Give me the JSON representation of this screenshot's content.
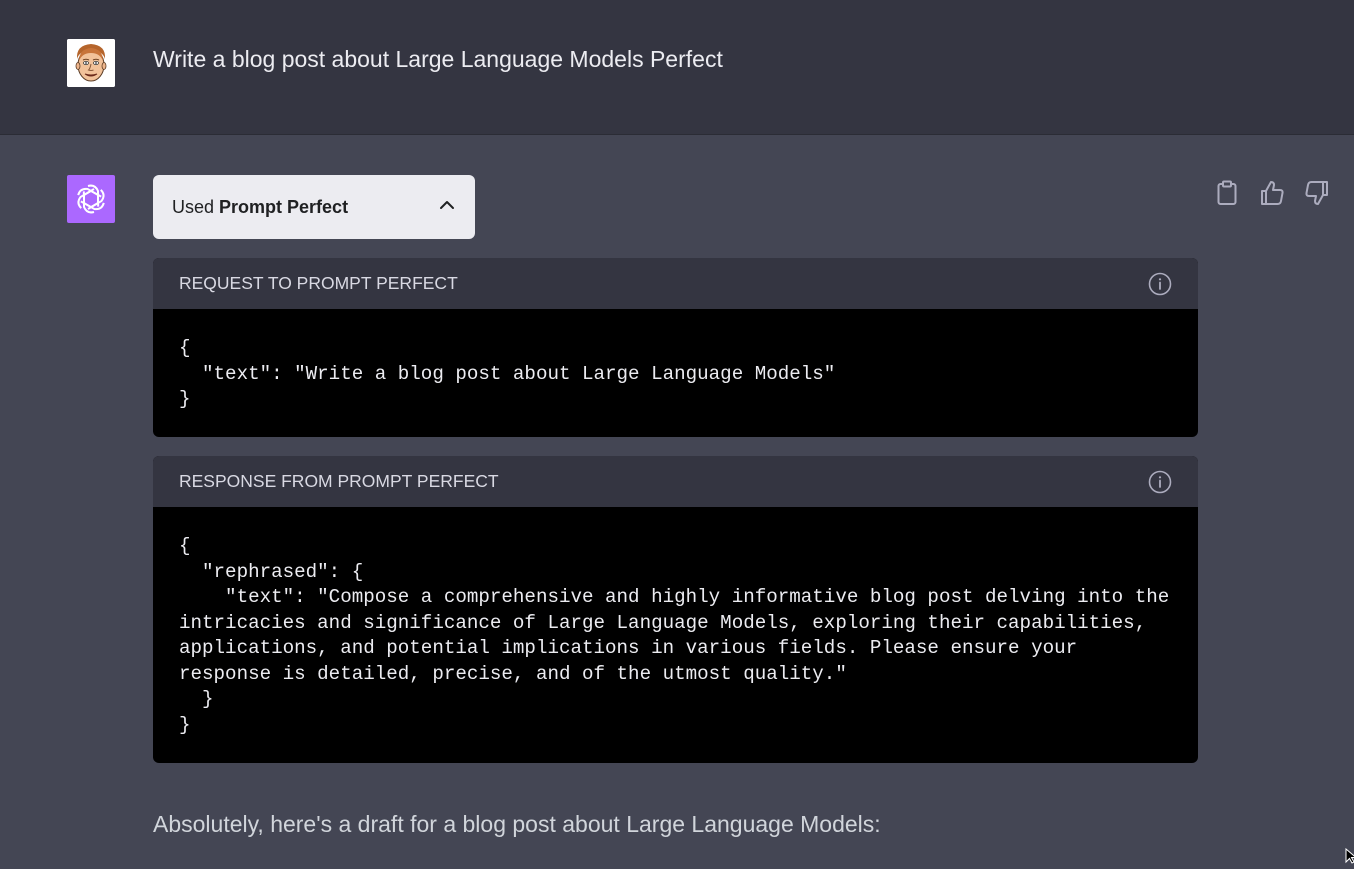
{
  "user": {
    "message": "Write a blog post about Large Language Models Perfect"
  },
  "assistant": {
    "plugin_used_prefix": "Used ",
    "plugin_name": "Prompt Perfect",
    "request_panel": {
      "title": "REQUEST TO PROMPT PERFECT",
      "code": "{\n  \"text\": \"Write a blog post about Large Language Models\"\n}"
    },
    "response_panel": {
      "title": "RESPONSE FROM PROMPT PERFECT",
      "code": "{\n  \"rephrased\": {\n    \"text\": \"Compose a comprehensive and highly informative blog post delving into the\nintricacies and significance of Large Language Models, exploring their capabilities,\napplications, and potential implications in various fields. Please ensure your\nresponse is detailed, precise, and of the utmost quality.\"\n  }\n}"
    },
    "answer_intro": "Absolutely, here's a draft for a blog post about Large Language Models:"
  },
  "icons": {
    "copy": "clipboard-icon",
    "like": "thumbs-up-icon",
    "dislike": "thumbs-down-icon",
    "collapse": "chevron-up-icon",
    "info": "info-icon",
    "assistant_logo": "openai-logo-icon"
  },
  "colors": {
    "user_bg": "#343541",
    "assistant_bg": "#444654",
    "gpt_avatar": "#ab68ff",
    "code_bg": "#000000",
    "panel_header_bg": "#343541",
    "toggle_bg": "#ececf1"
  }
}
